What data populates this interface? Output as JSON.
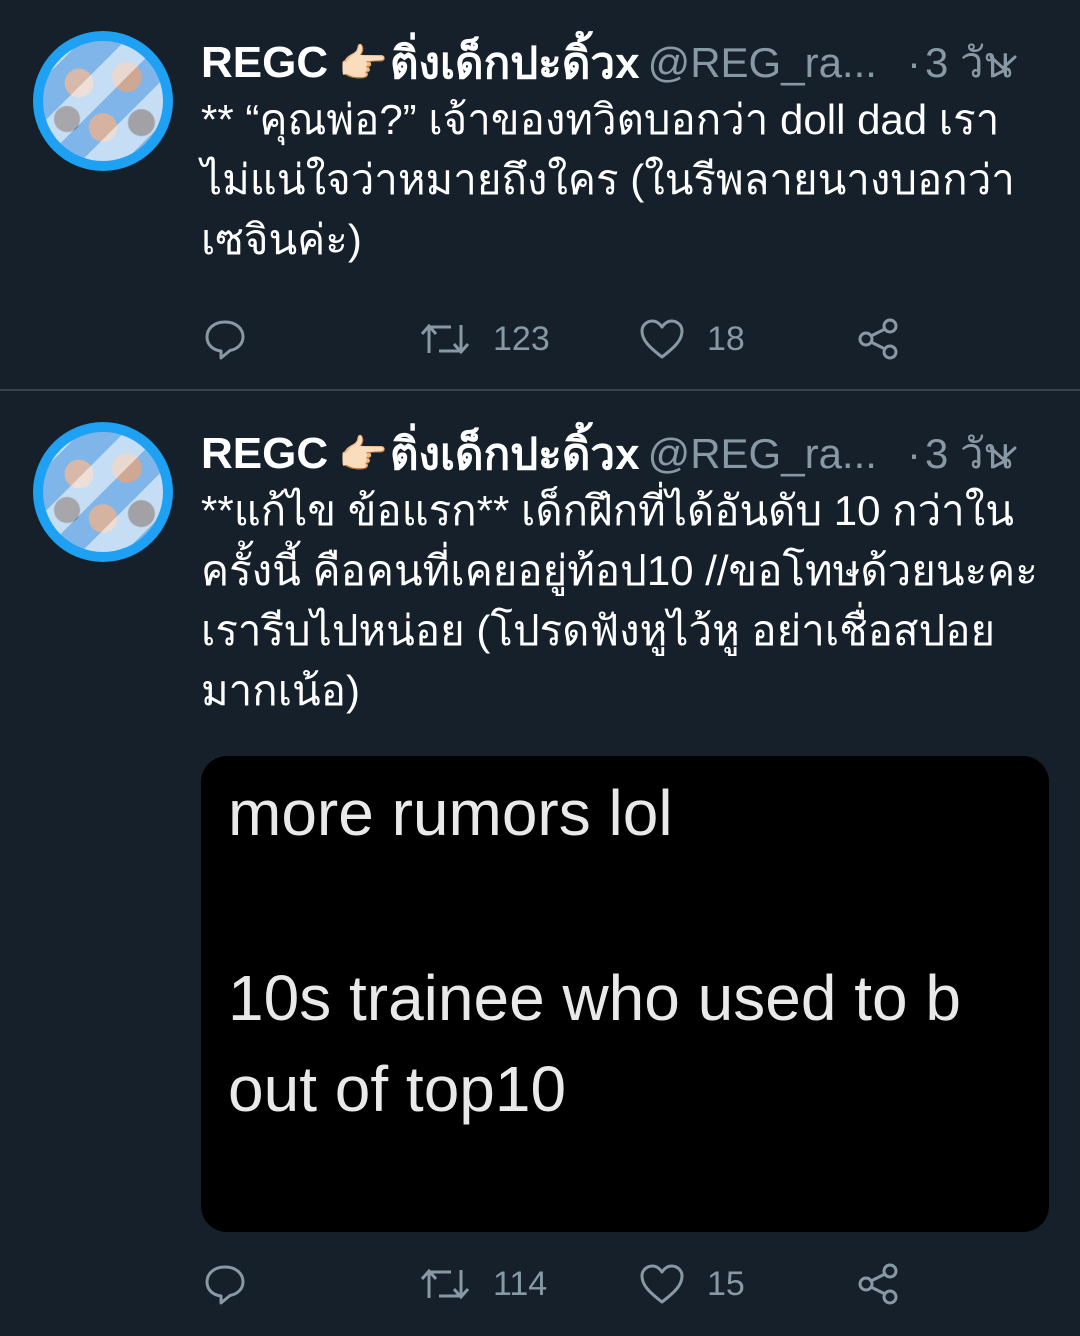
{
  "tweets": [
    {
      "display_name": "REGC",
      "emoji": "👉🏻",
      "name_suffix": "ติ่งเด็กปะดิ้วx",
      "handle": "@REG_ra...",
      "dot": "·",
      "time": "3 วัน",
      "text": "** “คุณพ่อ?” เจ้าของทวิตบอกว่า doll dad เรา ไม่แน่ใจว่าหมายถึงใคร (ในรีพลายนางบอกว่าเซจินค่ะ)",
      "retweets": "123",
      "likes": "18"
    },
    {
      "display_name": "REGC",
      "emoji": "👉🏻",
      "name_suffix": "ติ่งเด็กปะดิ้วx",
      "handle": "@REG_ra...",
      "dot": "·",
      "time": "3 วัน",
      "text": "**แก้ไข ข้อแรก** เด็กฝึกที่ได้อันดับ 10 กว่าในครั้งนี้ คือคนที่เคยอยู่ท้อป10 //ขอโทษด้วยนะคะ เรารีบไปหน่อย (โปรดฟังหูไว้หู อย่าเชื่อสปอยมากเน้อ)",
      "media": {
        "line1": "more rumors lol",
        "line2": "10s trainee who used to b",
        "line3": "out of top10"
      },
      "retweets": "114",
      "likes": "15"
    }
  ],
  "icons": {
    "reply": "reply-icon",
    "retweet": "retweet-icon",
    "like": "heart-icon",
    "share": "share-icon",
    "menu": "chevron-down-icon"
  },
  "colors": {
    "background": "#15202b",
    "secondary_text": "#8899a6",
    "divider": "#38444d",
    "avatar_ring": "#1ea1f2"
  }
}
